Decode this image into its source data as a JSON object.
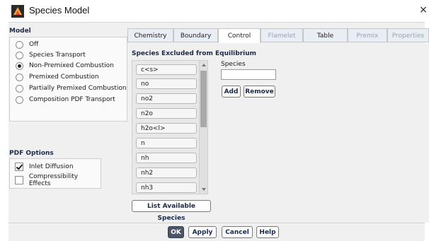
{
  "window": {
    "title": "Species Model",
    "close_label": "×"
  },
  "model": {
    "heading": "Model",
    "options": [
      {
        "label": "Off",
        "selected": false
      },
      {
        "label": "Species Transport",
        "selected": false
      },
      {
        "label": "Non-Premixed Combustion",
        "selected": true
      },
      {
        "label": "Premixed Combustion",
        "selected": false
      },
      {
        "label": "Partially Premixed Combustion",
        "selected": false
      },
      {
        "label": "Composition PDF Transport",
        "selected": false
      }
    ]
  },
  "pdf_options": {
    "heading": "PDF Options",
    "checks": [
      {
        "label": "Inlet Diffusion",
        "checked": true
      },
      {
        "label": "Compressibility Effects",
        "checked": false
      }
    ]
  },
  "tabs": [
    {
      "label": "Chemistry",
      "state": "normal"
    },
    {
      "label": "Boundary",
      "state": "normal"
    },
    {
      "label": "Control",
      "state": "active"
    },
    {
      "label": "Flamelet",
      "state": "disabled"
    },
    {
      "label": "Table",
      "state": "normal"
    },
    {
      "label": "Premix",
      "state": "disabled"
    },
    {
      "label": "Properties",
      "state": "disabled"
    }
  ],
  "control": {
    "excluded_heading": "Species Excluded from Equilibrium",
    "species_list": [
      "c<s>",
      "no",
      "no2",
      "n2o",
      "h2o<l>",
      "n",
      "nh",
      "nh2",
      "nh3"
    ],
    "species_label": "Species",
    "species_value": "",
    "add_label": "Add",
    "remove_label": "Remove",
    "list_available_label": "List Available Species"
  },
  "footer": {
    "ok_label": "OK",
    "apply_label": "Apply",
    "cancel_label": "Cancel",
    "help_label": "Help"
  },
  "colors": {
    "accent": "#4a5568",
    "panel": "#f0f0f0"
  }
}
